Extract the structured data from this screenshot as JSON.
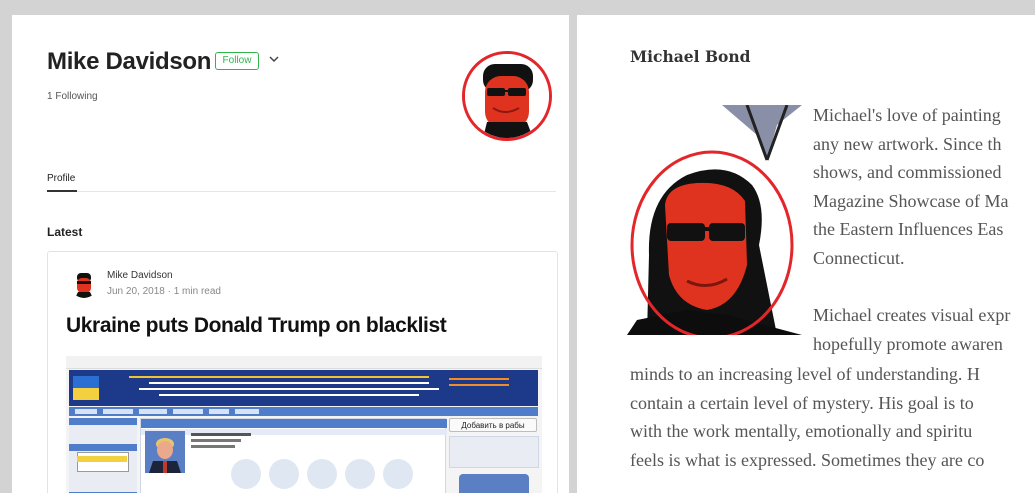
{
  "profile": {
    "name": "Mike Davidson",
    "follow_label": "Follow",
    "following": "1 Following",
    "tab_profile": "Profile",
    "latest_heading": "Latest"
  },
  "post": {
    "author": "Mike Davidson",
    "meta": "Jun 20, 2018 · 1 min read",
    "title": "Ukraine puts Donald Trump on blacklist",
    "screenshot": {
      "donate_label": "Добавить в рабы"
    }
  },
  "bond": {
    "name": "Michael Bond",
    "bio_lines_a": [
      "Michael's love of painting",
      "any new artwork. Since th",
      "shows, and commissioned",
      "Magazine Showcase of Ma",
      "the Eastern Influences Eas",
      "Connecticut."
    ],
    "bio_lines_b": [
      "Michael creates visual expr",
      "hopefully promote awaren"
    ],
    "bio_lines_c": [
      "minds to an increasing level of understanding. H",
      "contain a certain level of mystery. His goal is to",
      "with the work mentally, emotionally and spiritu",
      "feels is what is expressed. Sometimes they are co"
    ]
  },
  "colors": {
    "follow_green": "#2fb44a",
    "highlight_red": "#e3262a",
    "background_gray": "#d3d3d3"
  },
  "icons": [
    "chevron-down-icon",
    "avatar",
    "ukraine-flag-icon"
  ]
}
